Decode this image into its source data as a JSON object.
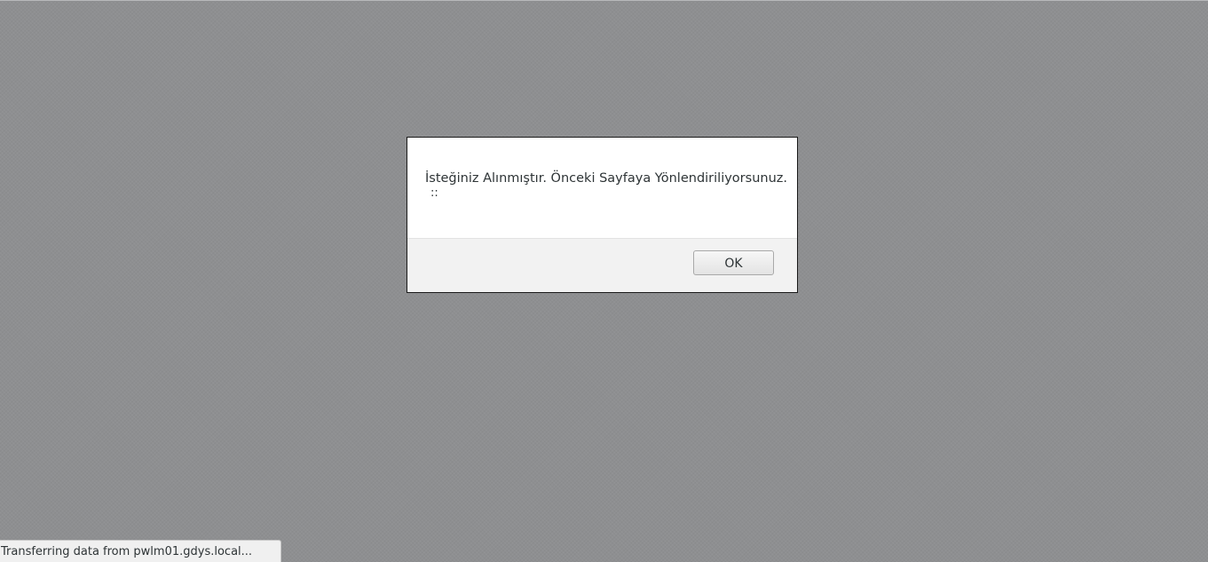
{
  "dialog": {
    "message": "İsteğiniz Alınmıştır. Önceki Sayfaya Yönlendiriliyorsunuz.",
    "sub_message": "::",
    "ok_label": "OK"
  },
  "status_bar": {
    "text": "Transferring data from pwlm01.gdys.local..."
  },
  "colors": {
    "overlay_background": "#8e8f91",
    "dialog_background": "#ffffff",
    "dialog_footer_background": "#f2f2f2",
    "status_bar_background": "#f0f0f0"
  }
}
